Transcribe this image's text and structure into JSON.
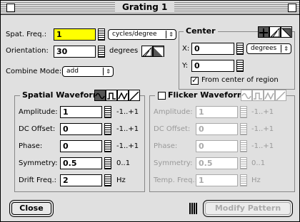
{
  "window": {
    "title": "Grating 1"
  },
  "top": {
    "spat_freq_label": "Spat. Freq.:",
    "spat_freq_value": "1",
    "spat_freq_unit": "cycles/degree",
    "orientation_label": "Orientation:",
    "orientation_value": "30",
    "orientation_unit": "degrees",
    "combine_label": "Combine Mode:",
    "combine_value": "add"
  },
  "center": {
    "title": "Center",
    "x_label": "X:",
    "x_value": "0",
    "y_label": "Y:",
    "y_value": "0",
    "unit": "degrees",
    "checkbox_label": "From center of region",
    "checkbox_checked": true
  },
  "spatial": {
    "title": "Spatial Waveform",
    "rows": [
      {
        "label": "Amplitude:",
        "value": "1",
        "range": "-1..+1"
      },
      {
        "label": "DC Offset:",
        "value": "0",
        "range": "-1..+1"
      },
      {
        "label": "Phase:",
        "value": "0",
        "range": "-1..+1"
      },
      {
        "label": "Symmetry:",
        "value": "0.5",
        "range": "0..1"
      },
      {
        "label": "Drift Freq.:",
        "value": "2",
        "range": "Hz"
      }
    ]
  },
  "flicker": {
    "title": "Flicker Waveform",
    "rows": [
      {
        "label": "Amplitude:",
        "value": "1",
        "range": "-1..+1"
      },
      {
        "label": "DC Offset:",
        "value": "0",
        "range": "-1..+1"
      },
      {
        "label": "Phase:",
        "value": "0",
        "range": "-1..+1"
      },
      {
        "label": "Symmetry:",
        "value": "0.5",
        "range": "0..1"
      },
      {
        "label": "Temp. Freq.:",
        "value": "1",
        "range": "Hz"
      }
    ]
  },
  "buttons": {
    "close": "Close",
    "modify": "Modify Pattern"
  },
  "colors": {
    "highlight": "#ffff00",
    "disabled": "#999999"
  }
}
